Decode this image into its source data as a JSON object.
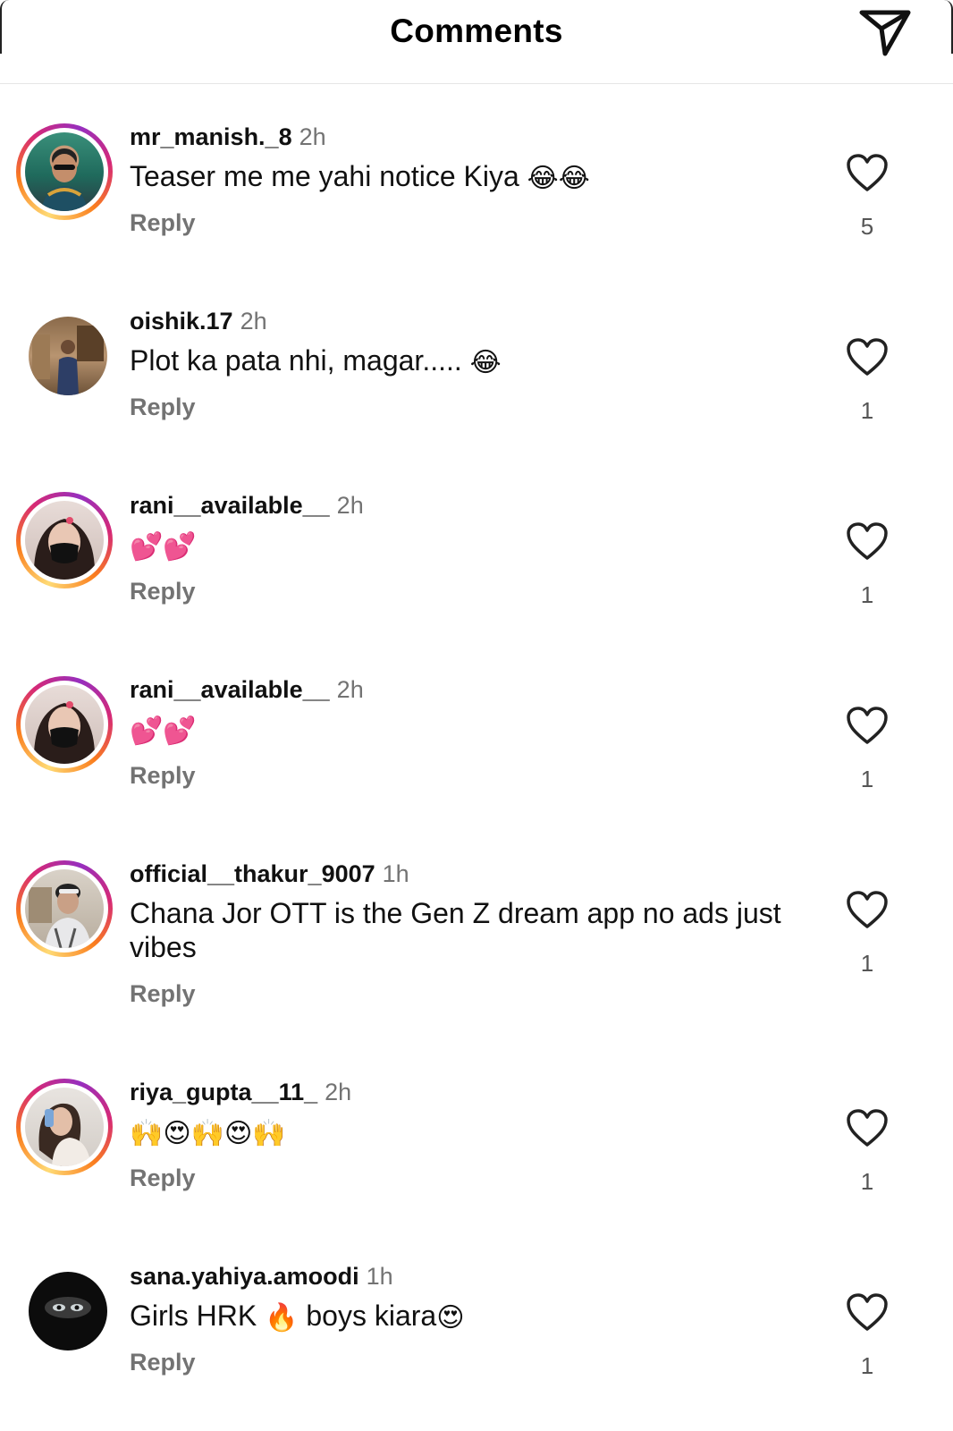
{
  "header": {
    "title": "Comments",
    "share_icon": "paper-plane-icon"
  },
  "colors": {
    "story_ring": [
      "#feda75",
      "#fa7e1e",
      "#d62976",
      "#962fbf"
    ],
    "secondary_text": "#737373",
    "divider": "#e6e6e6"
  },
  "comments": [
    {
      "username": "mr_manish._8",
      "time": "2h",
      "text": "Teaser me me yahi notice Kiya ",
      "emojis": "😂😂",
      "reply_label": "Reply",
      "likes": "5",
      "has_story_ring": true
    },
    {
      "username": "oishik.17",
      "time": "2h",
      "text": "Plot ka pata nhi, magar..... ",
      "emojis": "😂",
      "reply_label": "Reply",
      "likes": "1",
      "has_story_ring": false
    },
    {
      "username": "rani__available__",
      "time": "2h",
      "text": "",
      "emojis": "💕💕",
      "reply_label": "Reply",
      "likes": "1",
      "has_story_ring": true
    },
    {
      "username": "rani__available__",
      "time": "2h",
      "text": "",
      "emojis": "💕💕",
      "reply_label": "Reply",
      "likes": "1",
      "has_story_ring": true
    },
    {
      "username": "official__thakur_9007",
      "time": "1h",
      "text": "Chana Jor OTT is the Gen Z dream app no ads just vibes",
      "emojis": "",
      "reply_label": "Reply",
      "likes": "1",
      "has_story_ring": true
    },
    {
      "username": "riya_gupta__11_",
      "time": "2h",
      "text": "",
      "emojis": "🙌😍🙌😍🙌",
      "reply_label": "Reply",
      "likes": "1",
      "has_story_ring": true
    },
    {
      "username": "sana.yahiya.amoodi",
      "time": "1h",
      "text": "Girls HRK ",
      "emojis": "🔥",
      "text_after": " boys kiara",
      "emojis_after": "😍",
      "reply_label": "Reply",
      "likes": "1",
      "has_story_ring": false
    }
  ]
}
